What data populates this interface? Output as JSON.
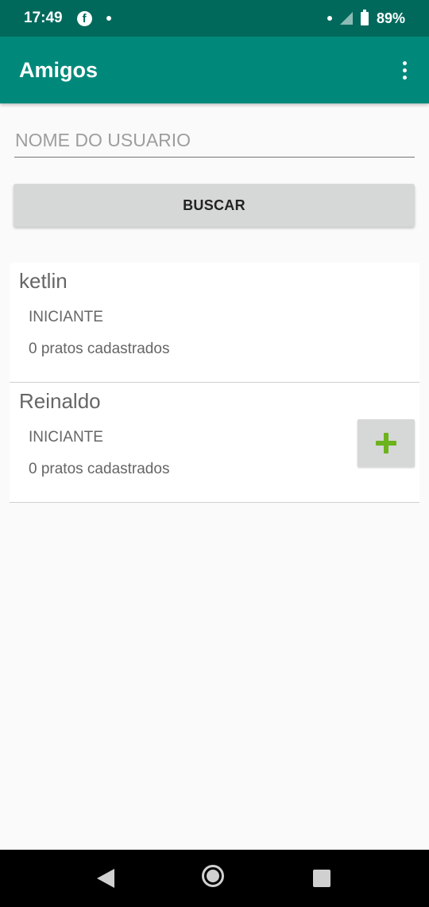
{
  "status_bar": {
    "time": "17:49",
    "battery": "89%",
    "icons": [
      "facebook-icon",
      "notification-dot-icon",
      "signal-icon",
      "battery-icon"
    ]
  },
  "app_bar": {
    "title": "Amigos",
    "menu_icon": "more-vert-icon"
  },
  "search": {
    "placeholder": "NOME DO USUARIO",
    "value": ""
  },
  "buscar_label": "BUSCAR",
  "friends": [
    {
      "name": "ketlin",
      "level": "INICIANTE",
      "count": "0 pratos cadastrados",
      "has_add_button": false
    },
    {
      "name": "Reinaldo",
      "level": "INICIANTE",
      "count": "0 pratos cadastrados",
      "has_add_button": true
    }
  ],
  "colors": {
    "status_bar": "#00695c",
    "app_bar": "#00897b",
    "add_icon": "#6cb31d",
    "button_bg": "#d6d7d7"
  },
  "nav_bar": {
    "icons": [
      "back-icon",
      "home-icon",
      "recents-icon"
    ]
  }
}
